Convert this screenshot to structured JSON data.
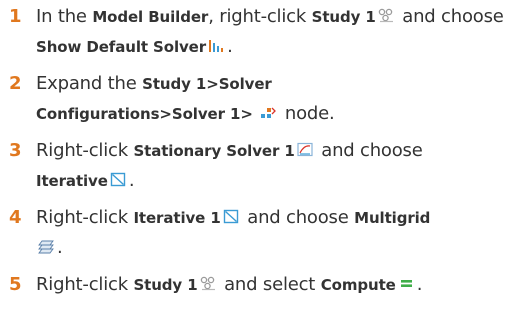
{
  "steps": [
    {
      "number": "1",
      "segments": [
        {
          "t": "In the ",
          "b": false
        },
        {
          "t": "Model Builder",
          "b": true
        },
        {
          "t": ", right-click ",
          "b": false
        },
        {
          "t": "Study 1",
          "b": true
        },
        {
          "icon": "study-icon"
        },
        {
          "t": " and choose ",
          "b": false
        },
        {
          "t": "Show Default Solver",
          "b": true
        },
        {
          "icon": "solver-sequence-icon"
        },
        {
          "t": ".",
          "b": false
        }
      ]
    },
    {
      "number": "2",
      "segments": [
        {
          "t": "Expand the ",
          "b": false
        },
        {
          "t": "Study 1>Solver",
          "b": true
        },
        {
          "br": true
        },
        {
          "t": "Configurations>Solver 1>",
          "b": true
        },
        {
          "t": " ",
          "b": false
        },
        {
          "icon": "solver-node-icon"
        },
        {
          "t": " node.",
          "b": false
        }
      ]
    },
    {
      "number": "3",
      "segments": [
        {
          "t": "Right-click ",
          "b": false
        },
        {
          "t": "Stationary Solver 1",
          "b": true
        },
        {
          "icon": "stationary-solver-icon"
        },
        {
          "t": " and choose",
          "b": false
        },
        {
          "br": true
        },
        {
          "t": "Iterative",
          "b": true
        },
        {
          "icon": "iterative-icon"
        },
        {
          "t": ".",
          "b": false
        }
      ]
    },
    {
      "number": "4",
      "segments": [
        {
          "t": "Right-click ",
          "b": false
        },
        {
          "t": "Iterative 1",
          "b": true
        },
        {
          "icon": "iterative-icon"
        },
        {
          "t": " and choose ",
          "b": false
        },
        {
          "t": "Multigrid",
          "b": true
        },
        {
          "br": true
        },
        {
          "icon": "multigrid-icon"
        },
        {
          "t": ".",
          "b": false
        }
      ]
    },
    {
      "number": "5",
      "segments": [
        {
          "t": "Right-click ",
          "b": false
        },
        {
          "t": "Study 1",
          "b": true
        },
        {
          "icon": "study-icon"
        },
        {
          "t": " and select ",
          "b": false
        },
        {
          "t": "Compute",
          "b": true
        },
        {
          "icon": "compute-icon"
        },
        {
          "t": ".",
          "b": false
        }
      ]
    }
  ],
  "colors": {
    "step_number": "#e0781f",
    "text": "#333333"
  }
}
